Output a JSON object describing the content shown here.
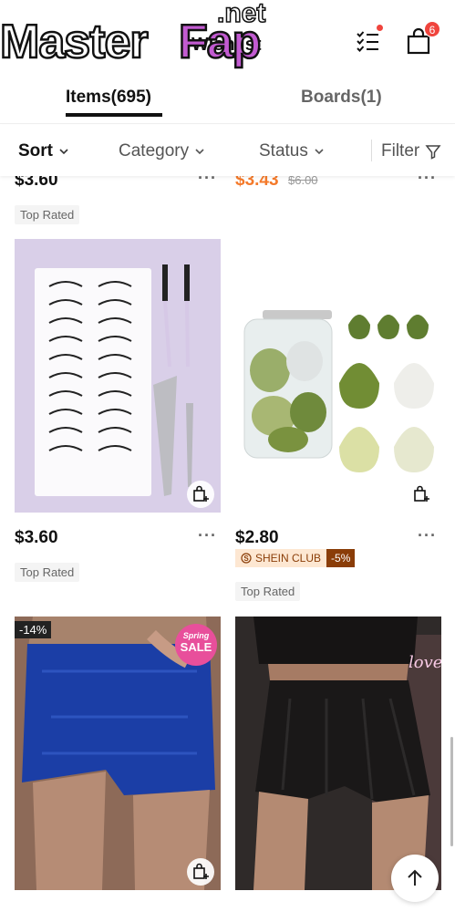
{
  "watermark": {
    "master": "Master",
    "fap": "Fap",
    "net": ".net",
    "wishlist": "Wishlist"
  },
  "header": {
    "cart_count": "6"
  },
  "tabs": {
    "items": "Items(695)",
    "boards": "Boards(1)"
  },
  "filter_bar": {
    "sort": "Sort",
    "category": "Category",
    "status": "Status",
    "filter": "Filter"
  },
  "products": [
    {
      "price": "$3.60",
      "tag": "Top Rated"
    },
    {
      "price": "$3.43",
      "old_price": "$6.00"
    },
    {
      "price": "$3.60",
      "tag": "Top Rated",
      "image": "false-eyelashes-kit"
    },
    {
      "price": "$2.80",
      "club_label": "SHEIN CLUB",
      "club_discount": "-5%",
      "tag": "Top Rated",
      "image": "makeup-sponge-jar"
    },
    {
      "discount": "-14%",
      "badge_top": "Spring",
      "badge_bottom": "SALE",
      "image": "blue-sequin-skort"
    },
    {
      "image": "black-flared-skort"
    }
  ],
  "colors": {
    "accent_orange": "#f47a2b",
    "badge_red": "#f0443d",
    "club_brown": "#8a3d08"
  }
}
